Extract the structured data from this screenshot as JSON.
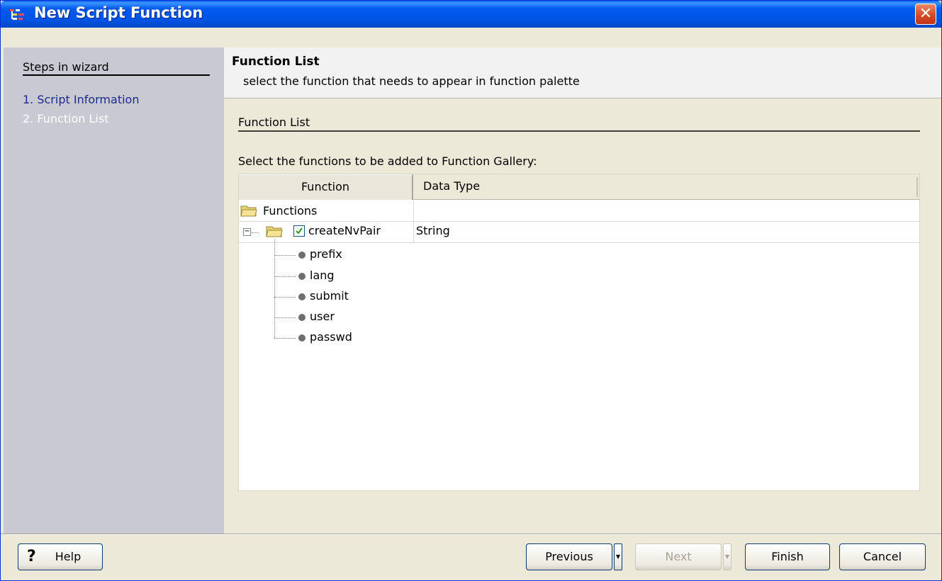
{
  "window": {
    "title": "New Script Function",
    "close_label": "✕"
  },
  "steps": {
    "title": "Steps in wizard",
    "items": [
      "1. Script Information",
      "2. Function List"
    ]
  },
  "header": {
    "title": "Function List",
    "subtitle": "select the function that needs to appear in function palette"
  },
  "section": {
    "label": "Function List",
    "prompt": "Select the functions to be added to Function Gallery:"
  },
  "table": {
    "columns": [
      "Function",
      "Data Type"
    ],
    "root": {
      "label": "Functions",
      "data_type": ""
    },
    "function": {
      "label": "createNvPair",
      "data_type": "String",
      "checked": true,
      "expanded": true
    },
    "params": [
      "prefix",
      "lang",
      "submit",
      "user",
      "passwd"
    ]
  },
  "buttons": {
    "help": "Help",
    "previous": "Previous",
    "next": "Next",
    "finish": "Finish",
    "cancel": "Cancel"
  },
  "icons": {
    "title": "wizard-icon",
    "help": "help-question-icon",
    "folder": "folder-icon",
    "param": "parameter-dot-icon"
  },
  "colors": {
    "titlebar": "#0055e5",
    "steps_panel": "#c9c9d3",
    "dialog_bg": "#ece9d8"
  }
}
